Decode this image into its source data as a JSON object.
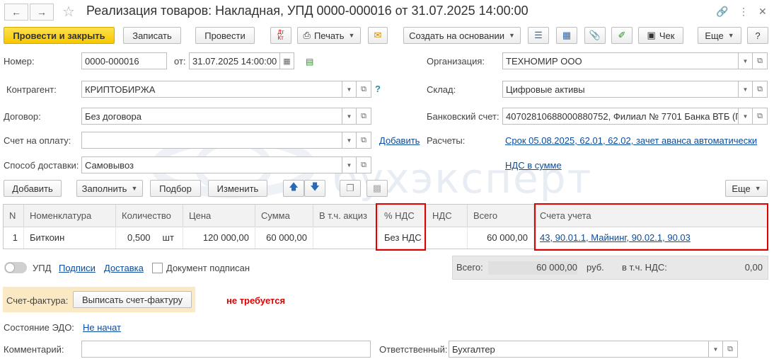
{
  "window": {
    "title": "Реализация товаров: Накладная, УПД 0000-000016 от 31.07.2025 14:00:00"
  },
  "toolbar": {
    "post_and_close": "Провести и закрыть",
    "save": "Записать",
    "post": "Провести",
    "dt_kt": "Дт Кт",
    "print": "Печать",
    "create_based_on": "Создать на основании",
    "check": "Чек",
    "more": "Еще",
    "help": "?"
  },
  "header": {
    "number_label": "Номер:",
    "number_value": "0000-000016",
    "date_label": "от:",
    "date_value": "31.07.2025 14:00:00",
    "contractor_label": "Контрагент:",
    "contractor_value": "КРИПТОБИРЖА",
    "contract_label": "Договор:",
    "contract_value": "Без договора",
    "invoice_label": "Счет на оплату:",
    "invoice_value": "",
    "add_link": "Добавить",
    "delivery_label": "Способ доставки:",
    "delivery_value": "Самовывоз",
    "org_label": "Организация:",
    "org_value": "ТЕХНОМИР ООО",
    "warehouse_label": "Склад:",
    "warehouse_value": "Цифровые активы",
    "bank_label": "Банковский счет:",
    "bank_value": "40702810688000880752, Филиал № 7701 Банка ВТБ (П",
    "settlements_label": "Расчеты:",
    "settlements_link": "Срок 05.08.2025, 62.01, 62.02, зачет аванса автоматически",
    "vat_link": "НДС в сумме",
    "help_mark": "?"
  },
  "table_toolbar": {
    "add": "Добавить",
    "fill": "Заполнить",
    "select": "Подбор",
    "change": "Изменить",
    "more": "Еще"
  },
  "table": {
    "columns": [
      "N",
      "Номенклатура",
      "Количество",
      "Цена",
      "Сумма",
      "В т.ч. акциз",
      "% НДС",
      "НДС",
      "Всего",
      "Счета учета"
    ],
    "rows": [
      {
        "n": "1",
        "item": "Биткоин",
        "qty": "0,500",
        "unit": "шт",
        "price": "120 000,00",
        "sum": "60 000,00",
        "excise": "",
        "vat_rate": "Без НДС",
        "vat": "",
        "total": "60 000,00",
        "accounts": "43, 90.01.1, Майнинг, 90.02.1, 90.03"
      }
    ]
  },
  "footer": {
    "upd_label": "УПД",
    "signers_link": "Подписи",
    "delivery_link": "Доставка",
    "signed_label": "Документ подписан",
    "total_label": "Всего:",
    "total_value": "60 000,00",
    "currency": "руб.",
    "vat_label": "в т.ч. НДС:",
    "vat_value": "0,00",
    "invoice_label": "Счет-фактура:",
    "issue_invoice_button": "Выписать счет-фактуру",
    "not_required": "не требуется",
    "edo_label": "Состояние ЭДО:",
    "edo_link": "Не начат",
    "comment_label": "Комментарий:",
    "comment_value": "",
    "responsible_label": "Ответственный:",
    "responsible_value": "Бухгалтер"
  },
  "watermark": "бухэксперт",
  "colors": {
    "primary_button": "#f7c800",
    "link": "#0b4c9c",
    "highlight": "#e00000",
    "invoice_panel": "#fbe9c3",
    "warning_text": "#e00000"
  }
}
